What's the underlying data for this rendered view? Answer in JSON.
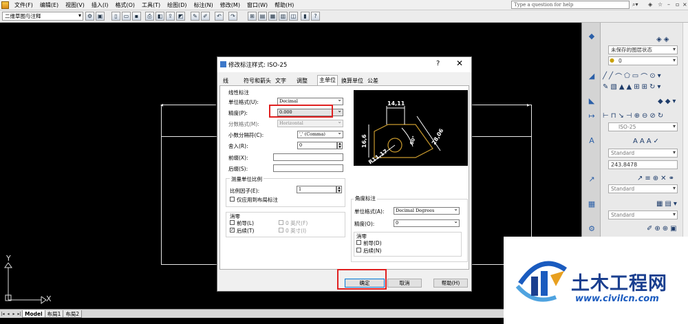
{
  "menubar": {
    "items": [
      "文件(F)",
      "编辑(E)",
      "视图(V)",
      "插入(I)",
      "格式(O)",
      "工具(T)",
      "绘图(D)",
      "标注(N)",
      "修改(M)",
      "窗口(W)",
      "帮助(H)"
    ],
    "help_placeholder": "Type a question for help"
  },
  "toolbar": {
    "workspace": "二维草图与注释"
  },
  "ucs": {
    "y": "Y",
    "x": "X"
  },
  "layout_tabs": [
    "Model",
    "布局1",
    "布局2"
  ],
  "right_panel": {
    "layer_state": "未保存的图层状态",
    "layer_current": "0",
    "dimstyle": "ISO-25",
    "textstyle": "Standard",
    "text_height": "243.8478",
    "mleader_style": "Standard",
    "table_style": "Standard"
  },
  "dialog": {
    "title": "修改标注样式: ISO-25",
    "help_glyph": "?",
    "close_glyph": "✕",
    "tabs": [
      "线",
      "符号和箭头",
      "文字",
      "调整",
      "主单位",
      "换算单位",
      "公差"
    ],
    "active_tab": "主单位",
    "linear": {
      "group": "线性标注",
      "unit_format_label": "单位格式(U):",
      "unit_format": "Decimal",
      "precision_label": "精度(P):",
      "precision": "0.000",
      "fraction_label": "分数格式(M):",
      "fraction": "Horizontal",
      "decimal_sep_label": "小数分隔符(C):",
      "decimal_sep": "','  (Comma)",
      "roundoff_label": "舍入(R):",
      "roundoff": "0",
      "prefix_label": "前缀(X):",
      "suffix_label": "后缀(S):"
    },
    "measurement": {
      "group": "测量单位比例",
      "scale_label": "比例因子(E):",
      "scale": "1",
      "layout_only": "仅应用到布局标注"
    },
    "zero_linear": {
      "group": "消零",
      "leading": "前导(L)",
      "trailing": "后续(T)",
      "feet": "0 英尺(F)",
      "inches": "0 英寸(I)",
      "leading_checked": false,
      "trailing_checked": true
    },
    "angular": {
      "group": "角度标注",
      "unit_format_label": "单位格式(A):",
      "unit_format": "Decimal Degrees",
      "precision_label": "精度(O):",
      "precision": "0",
      "zero_group": "消零",
      "leading": "前导(D)",
      "trailing": "后续(N)"
    },
    "preview_labels": [
      "14,11",
      "16,6",
      "28,06",
      "60°",
      "R11,17"
    ],
    "buttons": {
      "ok": "确定",
      "cancel": "取消",
      "help": "帮助(H)"
    },
    "highlight_color": "#e02020"
  },
  "watermark": {
    "title": "土木工程网",
    "url": "www.civilcn.com"
  }
}
